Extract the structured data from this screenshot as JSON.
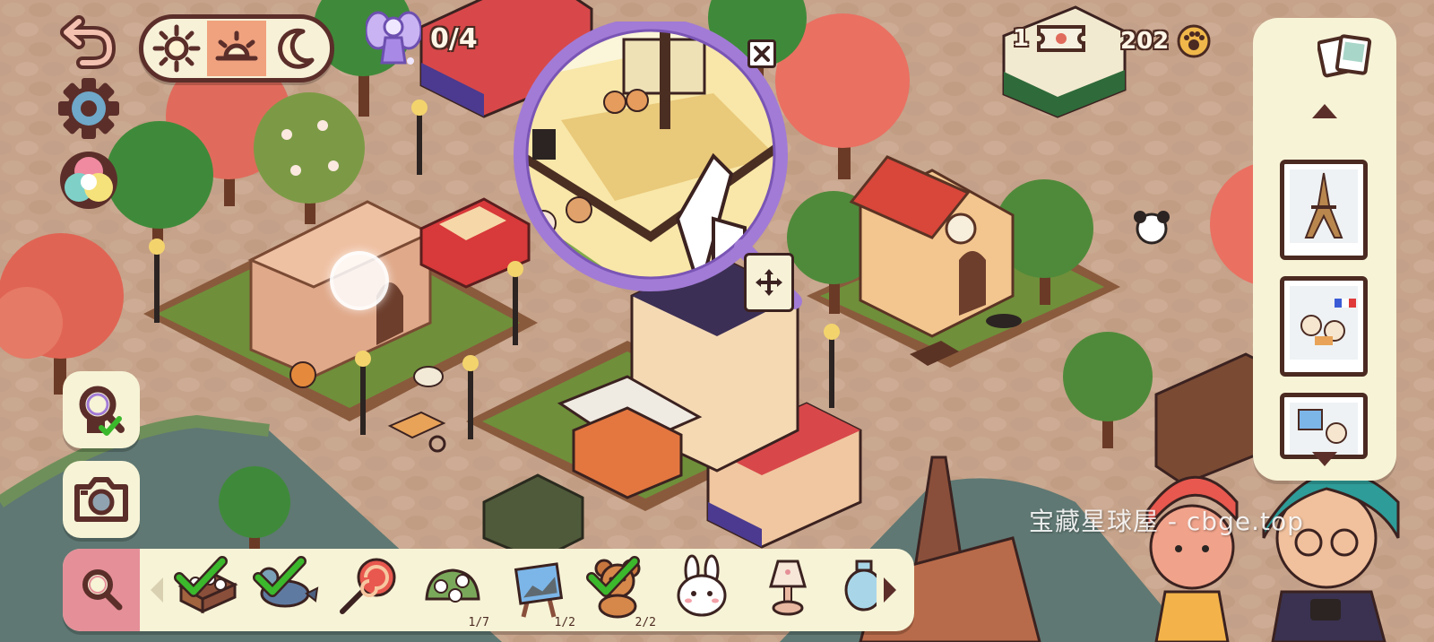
{
  "hud": {
    "fairy_progress": "0/4",
    "tickets": "1",
    "coins": "202",
    "time_of_day": {
      "options": [
        "day",
        "sunset",
        "night"
      ],
      "selected": "sunset"
    }
  },
  "left_toolbar": {
    "buttons": [
      {
        "name": "undo",
        "icon": "undo-arrow-icon"
      },
      {
        "name": "settings",
        "icon": "gear-icon"
      },
      {
        "name": "color-filter",
        "icon": "color-palette-icon"
      },
      {
        "name": "found-items",
        "icon": "magnifier-check-icon"
      },
      {
        "name": "camera",
        "icon": "camera-icon"
      }
    ]
  },
  "item_bar": {
    "items": [
      {
        "name": "flower-box",
        "icon": "flower-box-icon",
        "found": true,
        "count": ""
      },
      {
        "name": "pigeon",
        "icon": "pigeon-icon",
        "found": true,
        "count": ""
      },
      {
        "name": "lollipop",
        "icon": "lollipop-icon",
        "found": false,
        "count": ""
      },
      {
        "name": "rose-bush",
        "icon": "rose-bush-icon",
        "found": false,
        "count": "1/7"
      },
      {
        "name": "easel-painting",
        "icon": "easel-painting-icon",
        "found": false,
        "count": "1/2"
      },
      {
        "name": "teddy-bear",
        "icon": "teddy-bear-icon",
        "found": true,
        "count": "2/2"
      },
      {
        "name": "bunny-plush",
        "icon": "bunny-icon",
        "found": false,
        "count": ""
      },
      {
        "name": "lamp",
        "icon": "lamp-icon",
        "found": false,
        "count": ""
      },
      {
        "name": "vase",
        "icon": "vase-icon",
        "found": false,
        "count": ""
      }
    ]
  },
  "photo_panel": {
    "photos": [
      {
        "name": "eiffel-tower-photo",
        "icon": "eiffel-tower-icon"
      },
      {
        "name": "dogs-french-flag-photo",
        "icon": "dogs-flag-icon"
      },
      {
        "name": "cat-painting-photo",
        "icon": "painting-cat-icon"
      }
    ]
  },
  "watermark": "宝藏星球屋 - cbge.top",
  "colors": {
    "panel_bg": "#f7f3d6",
    "outline": "#4b2a22",
    "check_green": "#3bb82c",
    "magnifier_ring": "#a27bd6",
    "accent_pink": "#e58f98",
    "ground": "#c9a68d"
  }
}
